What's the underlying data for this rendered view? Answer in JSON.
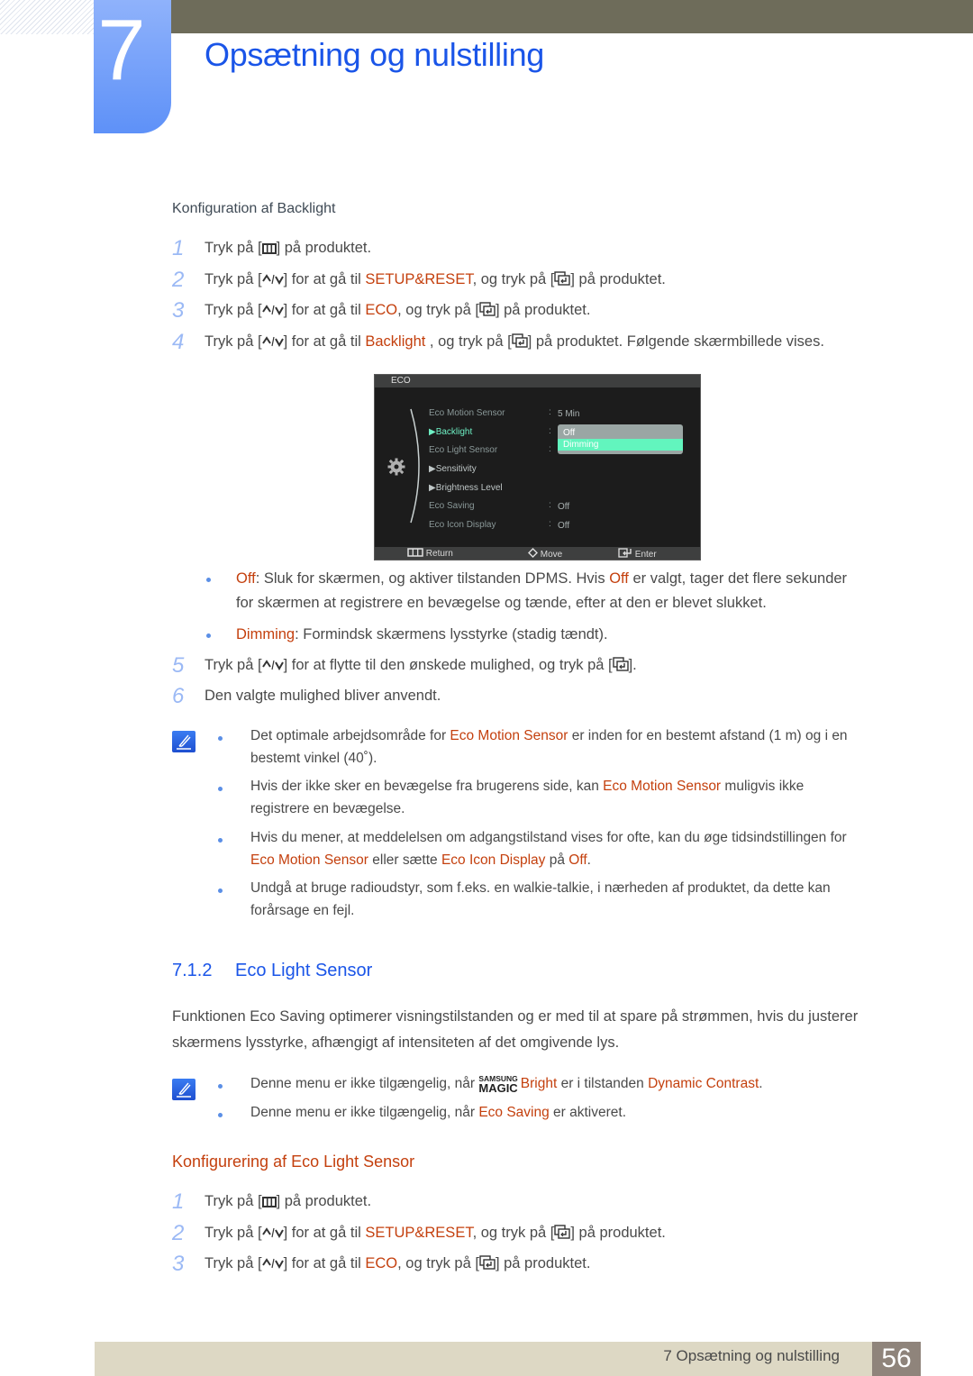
{
  "header": {
    "chapter_number": "7",
    "chapter_title": "Opsætning og nulstilling"
  },
  "backlight": {
    "heading": "Konfiguration af Backlight",
    "steps": [
      {
        "num": "1",
        "pre": "Tryk på [",
        "post": "] på produktet."
      },
      {
        "num": "2",
        "pre": "Tryk på [",
        "mid": "] for at gå til ",
        "hl": "SETUP&RESET",
        "mid2": ", og tryk på [",
        "post": "] på produktet."
      },
      {
        "num": "3",
        "pre": "Tryk på [",
        "mid": "] for at gå til ",
        "hl": "ECO",
        "mid2": ", og tryk på [",
        "post": "] på produktet."
      },
      {
        "num": "4",
        "pre": "Tryk på [",
        "mid": "] for at gå til ",
        "hl": "Backlight",
        "mid2": " , og tryk på [",
        "post": "] på produktet. Følgende skærmbillede vises."
      }
    ],
    "osd": {
      "title": "ECO",
      "items": [
        {
          "label": "Eco Motion Sensor",
          "value": "5 Min"
        },
        {
          "label": "▶Backlight",
          "value": ""
        },
        {
          "label": "Eco Light Sensor",
          "value": ""
        },
        {
          "label": "▶Sensitivity",
          "value": ""
        },
        {
          "label": "▶Brightness Level",
          "value": ""
        },
        {
          "label": "Eco Saving",
          "value": "Off"
        },
        {
          "label": "Eco Icon Display",
          "value": "Off"
        }
      ],
      "colon": ":",
      "dropdown": {
        "options": [
          "Off",
          "Dimming"
        ],
        "selected": "Dimming"
      },
      "footer": {
        "return": "Return",
        "move": "Move",
        "enter": "Enter"
      }
    },
    "options": [
      {
        "name": "Off",
        "text1": ": Sluk for skærmen, og aktiver tilstanden DPMS. Hvis ",
        "hl2": "Off",
        "text2": " er valgt, tager det flere sekunder",
        "line2": "for skærmen at registrere en bevægelse og tænde, efter at den er blevet slukket."
      },
      {
        "name": "Dimming",
        "text1": ": Formindsk skærmens lysstyrke (stadig tændt)."
      }
    ],
    "step5": {
      "num": "5",
      "pre": "Tryk på [",
      "mid": "] for at flytte til den ønskede mulighed, og tryk på [",
      "post": "]."
    },
    "step6": {
      "num": "6",
      "text": "Den valgte mulighed bliver anvendt."
    },
    "notes": [
      {
        "a": "Det optimale arbejdsområde for ",
        "hl": "Eco Motion Sensor",
        "b": " er inden for en bestemt afstand (1 m) og i en",
        "line2": "bestemt vinkel (40˚)."
      },
      {
        "a": "Hvis der ikke sker en bevægelse fra brugerens side, kan ",
        "hl": "Eco Motion Sensor",
        "b": " muligvis ikke",
        "line2": "registrere en bevægelse."
      },
      {
        "a": "Hvis du mener, at meddelelsen om adgangstilstand vises for ofte, kan du øge tidsindstillingen for",
        "hl1": "Eco Motion Sensor",
        "b1": " eller sætte ",
        "hl2": "Eco Icon Display",
        "b2": " på ",
        "hl3": "Off",
        "b3": "."
      },
      {
        "a": "Undgå at bruge radioudstyr, som f.eks. en walkie-talkie, i nærheden af produktet, da dette kan",
        "line2": "forårsage en fejl."
      }
    ]
  },
  "eco_light_sensor": {
    "section_number": "7.1.2",
    "section_title": "Eco Light Sensor",
    "paragraph": "Funktionen Eco Saving optimerer visningstilstanden og er med til at spare på strømmen, hvis du justerer skærmens lysstyrke, afhængigt af intensiteten af det omgivende lys.",
    "notes": [
      {
        "a": "Denne menu er ikke tilgængelig, når ",
        "logo_top": "SAMSUNG",
        "logo_bottom": "MAGIC",
        "hl1": "Bright",
        "b": " er i tilstanden ",
        "hl2": "Dynamic Contrast",
        "c": "."
      },
      {
        "a": "Denne menu er ikke tilgængelig, når ",
        "hl": "Eco Saving",
        "b": " er aktiveret."
      }
    ],
    "config_heading": "Konfigurering af Eco Light Sensor",
    "steps": [
      {
        "num": "1",
        "pre": "Tryk på [",
        "post": "] på produktet."
      },
      {
        "num": "2",
        "pre": "Tryk på [",
        "mid": "] for at gå til ",
        "hl": "SETUP&RESET",
        "mid2": ", og tryk på [",
        "post": "] på produktet."
      },
      {
        "num": "3",
        "pre": "Tryk på [",
        "mid": "] for at gå til ",
        "hl": "ECO",
        "mid2": ", og tryk på [",
        "post": "] på produktet."
      }
    ]
  },
  "footer": {
    "chapter_label": "7 Opsætning og nulstilling",
    "page_number": "56"
  }
}
